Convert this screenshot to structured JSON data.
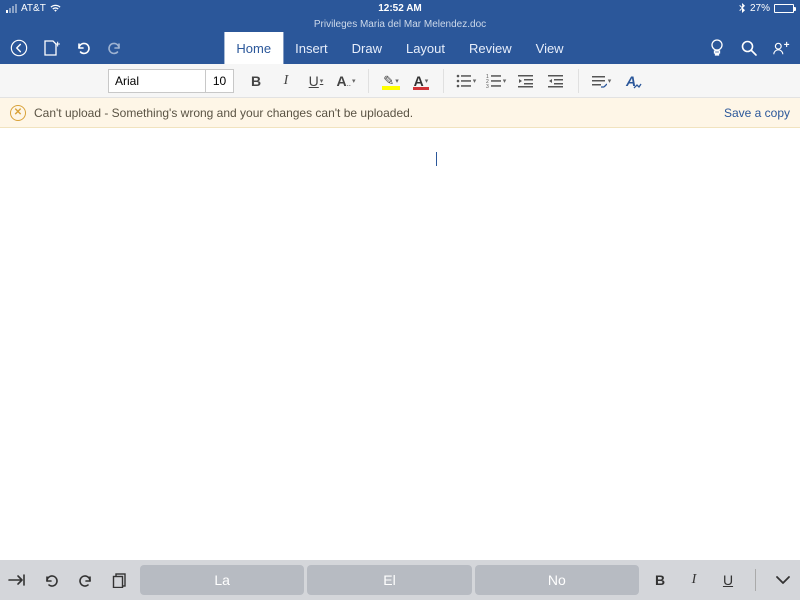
{
  "status": {
    "carrier": "AT&T",
    "time": "12:52 AM",
    "battery_pct": "27%"
  },
  "doc_title": "Privileges Maria del Mar Melendez.doc",
  "tabs": [
    "Home",
    "Insert",
    "Draw",
    "Layout",
    "Review",
    "View"
  ],
  "active_tab": "Home",
  "ribbon": {
    "font_name": "Arial",
    "font_size": "10"
  },
  "banner": {
    "message": "Can't upload - Something's wrong and your changes can't be uploaded.",
    "action": "Save a copy"
  },
  "suggestions": [
    "La",
    "El",
    "No"
  ]
}
